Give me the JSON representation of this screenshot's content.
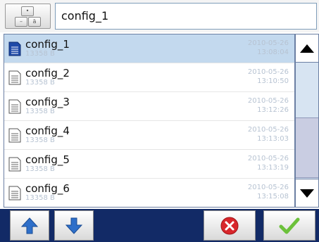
{
  "header": {
    "keyboard_icon": "keyboard-icon",
    "filename_value": "config_1"
  },
  "files": [
    {
      "name": "config_1",
      "size": "13358 B",
      "date": "2010-05-26",
      "time": "13:08:04",
      "selected": true
    },
    {
      "name": "config_2",
      "size": "13358 B",
      "date": "2010-05-26",
      "time": "13:10:50",
      "selected": false
    },
    {
      "name": "config_3",
      "size": "13358 B",
      "date": "2010-05-26",
      "time": "13:12:26",
      "selected": false
    },
    {
      "name": "config_4",
      "size": "13358 B",
      "date": "2010-05-26",
      "time": "13:13:03",
      "selected": false
    },
    {
      "name": "config_5",
      "size": "13358 B",
      "date": "2010-05-26",
      "time": "13:13:19",
      "selected": false
    },
    {
      "name": "config_6",
      "size": "13358 B",
      "date": "2010-05-26",
      "time": "13:15:08",
      "selected": false
    }
  ],
  "scrollbar": {
    "up_icon": "triangle-up-icon",
    "down_icon": "triangle-down-icon"
  },
  "toolbar": {
    "move_up_icon": "arrow-up-icon",
    "move_down_icon": "arrow-down-icon",
    "cancel_icon": "red-x-icon",
    "ok_icon": "green-check-icon"
  },
  "colors": {
    "selected_row": "#c3d9ee",
    "toolbar_bg": "#122a66",
    "meta_text": "#b7c3d2",
    "arrow_blue": "#2e6fc9",
    "cancel_red": "#d8262b",
    "ok_green": "#6cc13b"
  }
}
